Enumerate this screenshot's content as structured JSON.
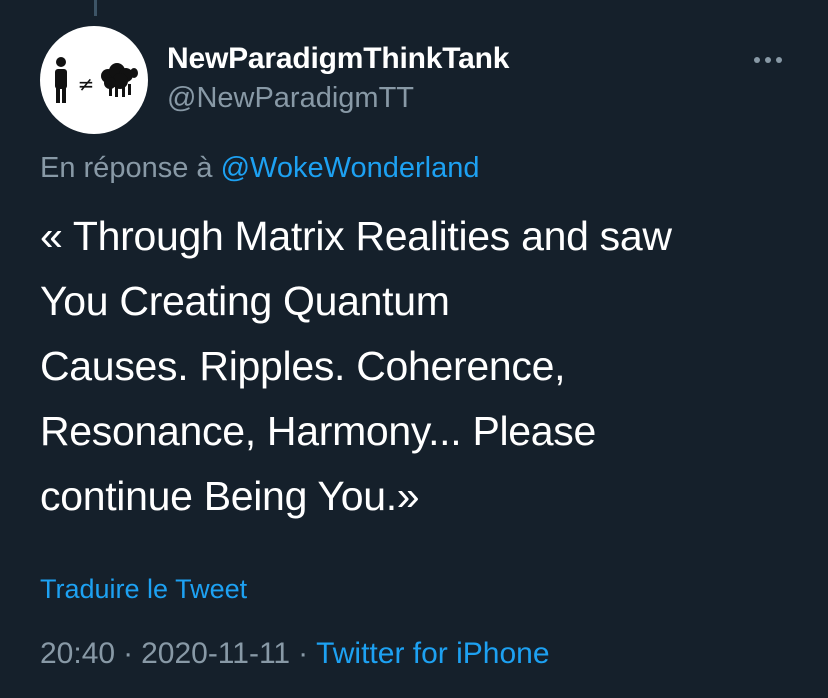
{
  "tweet": {
    "author": {
      "display_name": "NewParadigmThinkTank",
      "handle": "@NewParadigmTT",
      "avatar_icon": "person-not-equal-sheep-icon",
      "avatar_symbol": "≠"
    },
    "reply_to": {
      "prefix": "En réponse à",
      "mention": "@WokeWonderland"
    },
    "text_lines": [
      "« Through Matrix Realities and saw",
      "You Creating Quantum",
      "Causes. Ripples. Coherence,",
      "Resonance, Harmony... Please",
      "continue Being You.»"
    ],
    "translate_label": "Traduire le Tweet",
    "time": "20:40",
    "date": "2020-11-11",
    "separator": "·",
    "source": "Twitter for iPhone",
    "more_icon": "more-horizontal-icon"
  },
  "colors": {
    "background": "#15202b",
    "text_primary": "#ffffff",
    "text_secondary": "#8899a6",
    "accent": "#1da1f2"
  }
}
